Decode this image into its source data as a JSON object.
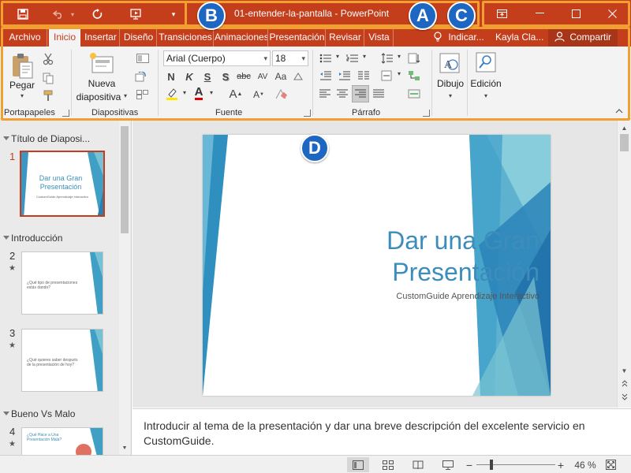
{
  "window": {
    "title": "01-entender-la-pantalla  -  PowerPoint",
    "quick_access": [
      "save-icon",
      "undo-icon",
      "repeat-icon",
      "start-from-beginning-icon",
      "customize-icon"
    ],
    "controls": [
      "ribbon-display-icon",
      "minimize-icon",
      "maximize-icon",
      "close-icon"
    ]
  },
  "callouts": {
    "a": "A",
    "b": "B",
    "c": "C",
    "d": "D"
  },
  "tabs": [
    "Archivo",
    "Inicio",
    "Insertar",
    "Diseño",
    "Transiciones",
    "Animaciones",
    "Presentación",
    "Revisar",
    "Vista"
  ],
  "active_tab": "Inicio",
  "tell_me": "Indicar...",
  "user": "Kayla Cla...",
  "share": "Compartir",
  "ribbon": {
    "clipboard": {
      "label": "Portapapeles",
      "paste": "Pegar"
    },
    "slides": {
      "label": "Diapositivas",
      "new_slide_1": "Nueva",
      "new_slide_2": "diapositiva"
    },
    "font": {
      "label": "Fuente",
      "font_name": "Arial (Cuerpo)",
      "font_size": "18",
      "bold": "N",
      "italic": "K",
      "underline": "S",
      "shadow": "S",
      "strike": "abc",
      "spacing": "AV",
      "case": "Aa",
      "font_color": "A",
      "grow": "A",
      "shrink": "A"
    },
    "paragraph": {
      "label": "Párrafo"
    },
    "drawing": {
      "label": "Dibujo"
    },
    "editing": {
      "label": "Edición"
    }
  },
  "thumbnails": {
    "sections": [
      "Título de Diaposi...",
      "Introducción",
      "Bueno Vs Malo"
    ],
    "slides": [
      {
        "num": "1",
        "title": "Dar una Gran Presentación",
        "text": "CustomGuide Aprendizaje Interactivo"
      },
      {
        "num": "2",
        "text": "¿Qué tipo de presentaciones estás dando?"
      },
      {
        "num": "3",
        "text": "¿Qué quieres saber después de la presentación de hoy?"
      },
      {
        "num": "4",
        "title": "¿Qué Hace a Una Presentación Mala?"
      }
    ],
    "star": "★"
  },
  "slide": {
    "title_line1": "Dar una Gran",
    "title_line2": "Presentación",
    "subtitle": "CustomGuide Aprendizaje Interactivo"
  },
  "notes": "Introducir al tema de la presentación y dar una breve descripción del excelente servicio en CustomGuide.",
  "status": {
    "zoom": "46 %",
    "minus": "−",
    "plus": "+"
  },
  "colors": {
    "accent": "#c43e1c",
    "frame": "#f0a030",
    "callout": "#1d66c1",
    "slide_blue": "#3c8dbb"
  }
}
